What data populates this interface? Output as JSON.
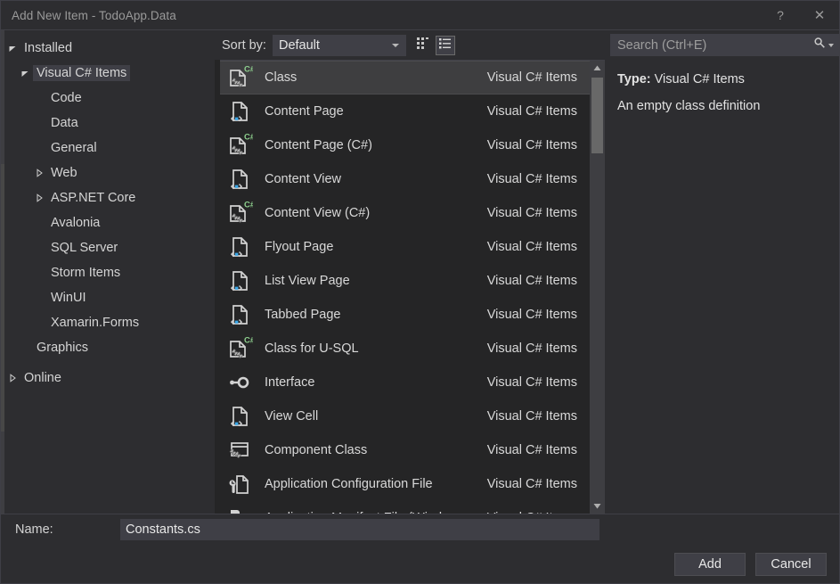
{
  "window": {
    "title": "Add New Item - TodoApp.Data",
    "help_label": "?",
    "close_label": "✕"
  },
  "sidebar": {
    "nodes": [
      {
        "label": "Installed",
        "level": 0,
        "expander": "expanded",
        "selected": false
      },
      {
        "label": "Visual C# Items",
        "level": 1,
        "expander": "expanded",
        "selected": true
      },
      {
        "label": "Code",
        "level": 2,
        "expander": "none",
        "selected": false
      },
      {
        "label": "Data",
        "level": 2,
        "expander": "none",
        "selected": false
      },
      {
        "label": "General",
        "level": 2,
        "expander": "none",
        "selected": false
      },
      {
        "label": "Web",
        "level": 2,
        "expander": "collapsed",
        "selected": false
      },
      {
        "label": "ASP.NET Core",
        "level": 2,
        "expander": "collapsed",
        "selected": false
      },
      {
        "label": "Avalonia",
        "level": 2,
        "expander": "none",
        "selected": false
      },
      {
        "label": "SQL Server",
        "level": 2,
        "expander": "none",
        "selected": false
      },
      {
        "label": "Storm Items",
        "level": 2,
        "expander": "none",
        "selected": false
      },
      {
        "label": "WinUI",
        "level": 2,
        "expander": "none",
        "selected": false
      },
      {
        "label": "Xamarin.Forms",
        "level": 2,
        "expander": "none",
        "selected": false
      },
      {
        "label": "Graphics",
        "level": 1,
        "expander": "none",
        "selected": false
      },
      {
        "label": "",
        "level": 0,
        "expander": "none",
        "selected": false
      },
      {
        "label": "Online",
        "level": 0,
        "expander": "collapsed",
        "selected": false
      }
    ]
  },
  "toolbar": {
    "sort_label": "Sort by:",
    "sort_value": "Default",
    "view_grid_icon": "medium-icons-view-icon",
    "view_list_icon": "details-list-view-icon",
    "active_view": "list"
  },
  "list": {
    "items": [
      {
        "name": "Class",
        "category": "Visual C# Items",
        "icon": "csharp-class-icon",
        "selected": true,
        "clipped": false
      },
      {
        "name": "Content Page",
        "category": "Visual C# Items",
        "icon": "xaml-document-icon",
        "selected": false,
        "clipped": false
      },
      {
        "name": "Content Page (C#)",
        "category": "Visual C# Items",
        "icon": "csharp-class-icon",
        "selected": false,
        "clipped": false
      },
      {
        "name": "Content View",
        "category": "Visual C# Items",
        "icon": "xaml-document-icon",
        "selected": false,
        "clipped": false
      },
      {
        "name": "Content View (C#)",
        "category": "Visual C# Items",
        "icon": "csharp-class-icon",
        "selected": false,
        "clipped": false
      },
      {
        "name": "Flyout Page",
        "category": "Visual C# Items",
        "icon": "xaml-document-icon",
        "selected": false,
        "clipped": false
      },
      {
        "name": "List View Page",
        "category": "Visual C# Items",
        "icon": "xaml-document-icon",
        "selected": false,
        "clipped": false
      },
      {
        "name": "Tabbed Page",
        "category": "Visual C# Items",
        "icon": "xaml-document-icon",
        "selected": false,
        "clipped": false
      },
      {
        "name": "Class for U-SQL",
        "category": "Visual C# Items",
        "icon": "csharp-class-icon",
        "selected": false,
        "clipped": false
      },
      {
        "name": "Interface",
        "category": "Visual C# Items",
        "icon": "interface-icon",
        "selected": false,
        "clipped": false
      },
      {
        "name": "View Cell",
        "category": "Visual C# Items",
        "icon": "xaml-document-icon",
        "selected": false,
        "clipped": false
      },
      {
        "name": "Component Class",
        "category": "Visual C# Items",
        "icon": "component-class-icon",
        "selected": false,
        "clipped": false
      },
      {
        "name": "Application Configuration File",
        "category": "Visual C# Items",
        "icon": "config-file-icon",
        "selected": false,
        "clipped": false
      },
      {
        "name": "Application Manifest File (Windows",
        "category": "Visual C# Items",
        "icon": "manifest-file-icon",
        "selected": false,
        "clipped": true
      }
    ]
  },
  "search": {
    "placeholder": "Search (Ctrl+E)",
    "icon": "magnifier-icon"
  },
  "details": {
    "type_label": "Type:",
    "type_value": "Visual C# Items",
    "description": "An empty class definition"
  },
  "footer": {
    "name_label": "Name:",
    "name_value": "Constants.cs",
    "add_label": "Add",
    "cancel_label": "Cancel"
  },
  "colors": {
    "window_bg": "#2d2d30",
    "list_bg": "#252526",
    "field_bg": "#3f3f46",
    "selection_bg": "#3e3e40",
    "text": "#d4d4d4",
    "csharp_green": "#8ed08e",
    "xaml_blue": "#3aa7e8"
  }
}
